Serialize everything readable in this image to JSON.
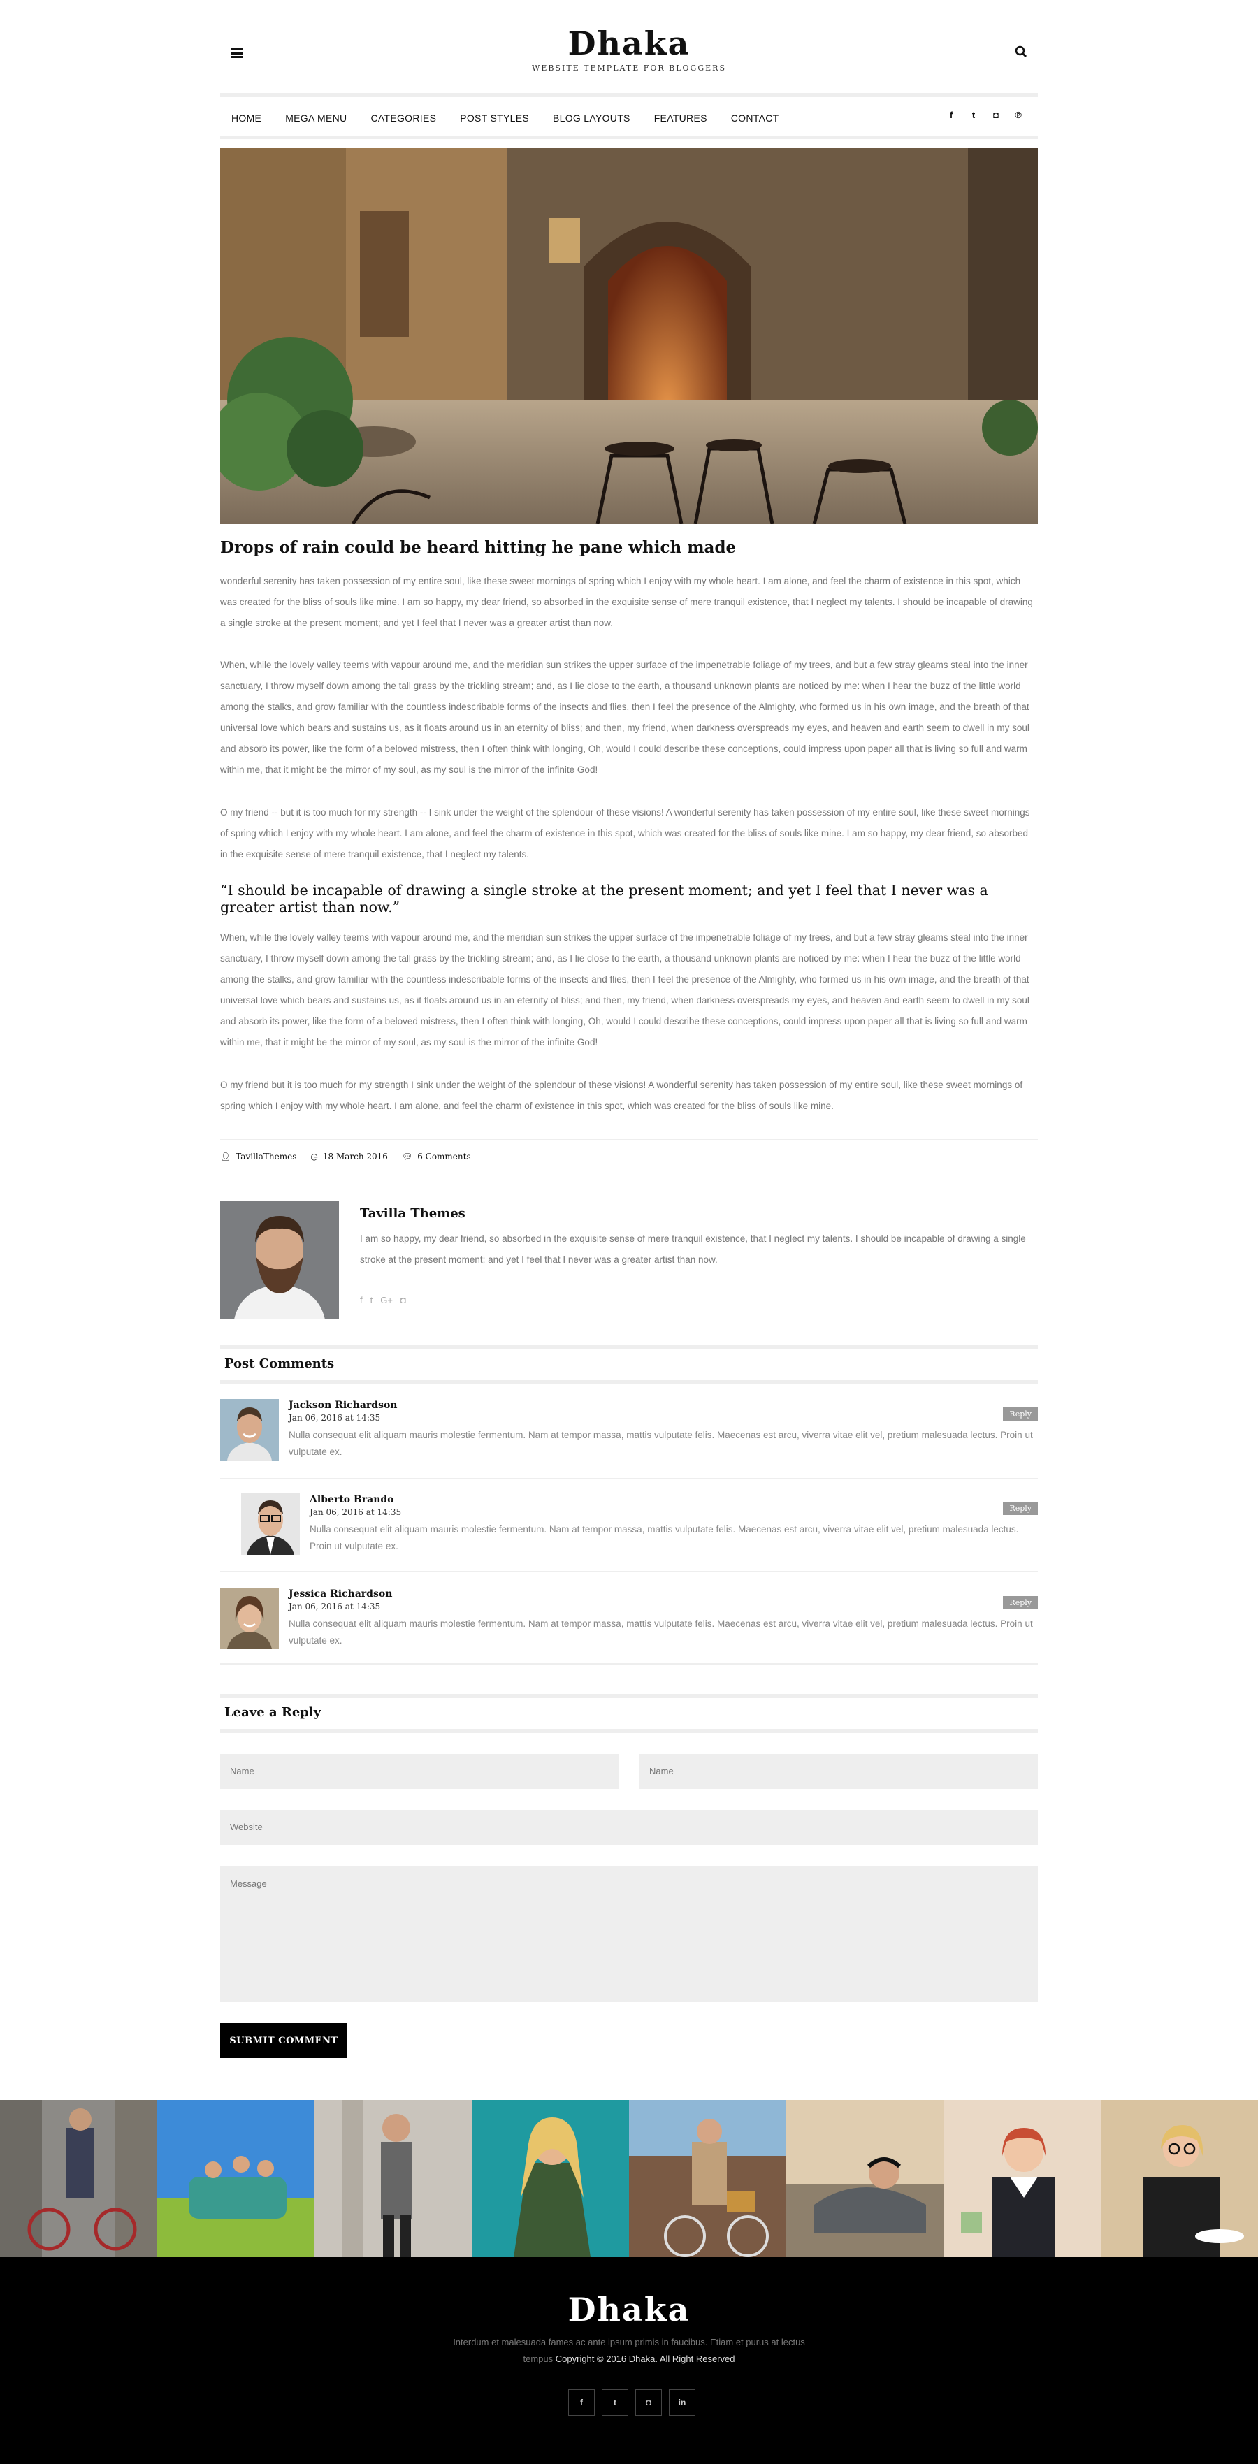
{
  "brand": {
    "title": "Dhaka",
    "tagline": "WEBSITE TEMPLATE FOR BLOGGERS"
  },
  "nav": {
    "items": [
      "HOME",
      "MEGA MENU",
      "CATEGORIES",
      "POST STYLES",
      "BLOG LAYOUTS",
      "FEATURES",
      "CONTACT"
    ],
    "social": [
      {
        "icon": "facebook-icon",
        "glyph": "f"
      },
      {
        "icon": "twitter-icon",
        "glyph": "t"
      },
      {
        "icon": "instagram-icon",
        "glyph": "◘"
      },
      {
        "icon": "pinterest-icon",
        "glyph": "℗"
      }
    ]
  },
  "post": {
    "title": "Drops of rain could be heard hitting he pane which made",
    "paragraphs": [
      " wonderful serenity has taken possession of my entire soul, like these sweet mornings of spring which I enjoy with my whole heart. I am alone, and feel the charm of existence in this spot, which was created for the bliss of souls like mine. I am so happy, my dear friend, so absorbed in the exquisite sense of mere tranquil existence, that I neglect my talents. I should be incapable of drawing a single stroke at the present moment; and yet I feel that I never was a greater artist than now.",
      "When, while the lovely valley teems with vapour around me, and the meridian sun strikes the upper surface of the impenetrable foliage of my trees, and but a few stray gleams steal into the inner sanctuary, I throw myself down among the tall grass by the trickling stream; and, as I lie close to the earth, a thousand unknown plants are noticed by me: when I hear the buzz of the little world among the stalks, and grow familiar with the countless indescribable forms of the insects and flies, then I feel the presence of the Almighty, who formed us in his own image, and the breath of that universal love which bears and sustains us, as it floats around us in an eternity of bliss; and then, my friend, when darkness overspreads my eyes, and heaven and earth seem to dwell in my soul and absorb its power, like the form of a beloved mistress, then I often think with longing, Oh, would I could describe these conceptions, could impress upon paper all that is living so full and warm within me, that it might be the mirror of my soul, as my soul is the mirror of the infinite God!",
      "O my friend -- but it is too much for my strength -- I sink under the weight of the splendour of these visions! A wonderful serenity has taken possession of my entire soul, like these sweet mornings of spring which I enjoy with my whole heart. I am alone, and feel the charm of existence in this spot, which was created for the bliss of souls like mine. I am so happy, my dear friend, so absorbed in the exquisite sense of mere tranquil existence, that I neglect my talents.",
      "When, while the lovely valley teems with vapour around me, and the meridian sun strikes the upper surface of the impenetrable foliage of my trees, and but a few stray gleams steal into the inner sanctuary, I throw myself down among the tall grass by the trickling stream; and, as I lie close to the earth, a thousand unknown plants are noticed by me: when I hear the buzz of the little world among the stalks, and grow familiar with the countless indescribable forms of the insects and flies, then I feel the presence of the Almighty, who formed us in his own image, and the breath of that universal love which bears and sustains us, as it floats around us in an eternity of bliss; and then, my friend, when darkness overspreads my eyes, and heaven and earth seem to dwell in my soul and absorb its power, like the form of a beloved mistress, then I often think with longing, Oh, would I could describe these conceptions, could impress upon paper all that is living so full and warm within me, that it might be the mirror of my soul, as my soul is the mirror of the infinite God!",
      "O my friend but it is too much for my strength I sink under the weight of the splendour of these visions! A wonderful serenity has taken possession of my entire soul, like these sweet mornings of spring which I enjoy with my whole heart. I am alone, and feel the charm of existence in this spot, which was created for the bliss of souls like mine."
    ],
    "quote": "“I should be incapable of drawing a single stroke at the present moment; and yet I feel that I never was a greater artist than now.”",
    "meta": {
      "author": "TavillaThemes",
      "date": "18 March 2016",
      "comments": "6 Comments"
    }
  },
  "author_box": {
    "name": "Tavilla Themes",
    "bio": "I am so happy, my dear friend, so absorbed in the exquisite sense of mere tranquil existence, that I neglect my talents. I should be incapable of drawing a single stroke at the present moment; and yet I feel that I never was a greater artist than now.",
    "social": [
      {
        "icon": "facebook-icon",
        "glyph": "f"
      },
      {
        "icon": "twitter-icon",
        "glyph": "t"
      },
      {
        "icon": "google-plus-icon",
        "glyph": "G+"
      },
      {
        "icon": "instagram-icon",
        "glyph": "◘"
      }
    ]
  },
  "comments": {
    "title": "Post Comments",
    "reply_label": "Reply",
    "items": [
      {
        "name": "Jackson Richardson",
        "date": "Jan 06, 2016 at 14:35",
        "text": "Nulla consequat elit aliquam mauris molestie fermentum. Nam at tempor massa, mattis vulputate felis. Maecenas est arcu, viverra vitae elit vel, pretium malesuada lectus. Proin ut vulputate ex."
      },
      {
        "name": "Alberto Brando",
        "date": "Jan 06, 2016 at 14:35",
        "text": "Nulla consequat elit aliquam mauris molestie fermentum. Nam at tempor massa, mattis vulputate felis. Maecenas est arcu, viverra vitae elit vel, pretium malesuada lectus. Proin ut vulputate ex."
      },
      {
        "name": "Jessica Richardson",
        "date": "Jan 06, 2016 at 14:35",
        "text": "Nulla consequat elit aliquam mauris molestie fermentum. Nam at tempor massa, mattis vulputate felis. Maecenas est arcu, viverra vitae elit vel, pretium malesuada lectus. Proin ut vulputate ex."
      }
    ]
  },
  "reply_form": {
    "title": "Leave a Reply",
    "name_placeholder": "Name",
    "name2_placeholder": "Name",
    "website_placeholder": "Website",
    "message_placeholder": "Message",
    "submit_label": "SUBMIT COMMENT"
  },
  "footer": {
    "brand": "Dhaka",
    "line1": "Interdum et malesuada fames ac ante ipsum primis in faucibus. Etiam et purus at lectus",
    "line2_muted": "tempus",
    "line2_copyright": "Copyright © 2016 Dhaka. All Right Reserved",
    "social": [
      {
        "icon": "facebook-icon",
        "glyph": "f"
      },
      {
        "icon": "twitter-icon",
        "glyph": "t"
      },
      {
        "icon": "instagram-icon",
        "glyph": "◘"
      },
      {
        "icon": "linkedin-icon",
        "glyph": "in"
      }
    ]
  },
  "colors": {
    "accent": "#000000",
    "muted_text": "#777777",
    "rule": "#eeeeee",
    "reply_badge": "#999999"
  }
}
